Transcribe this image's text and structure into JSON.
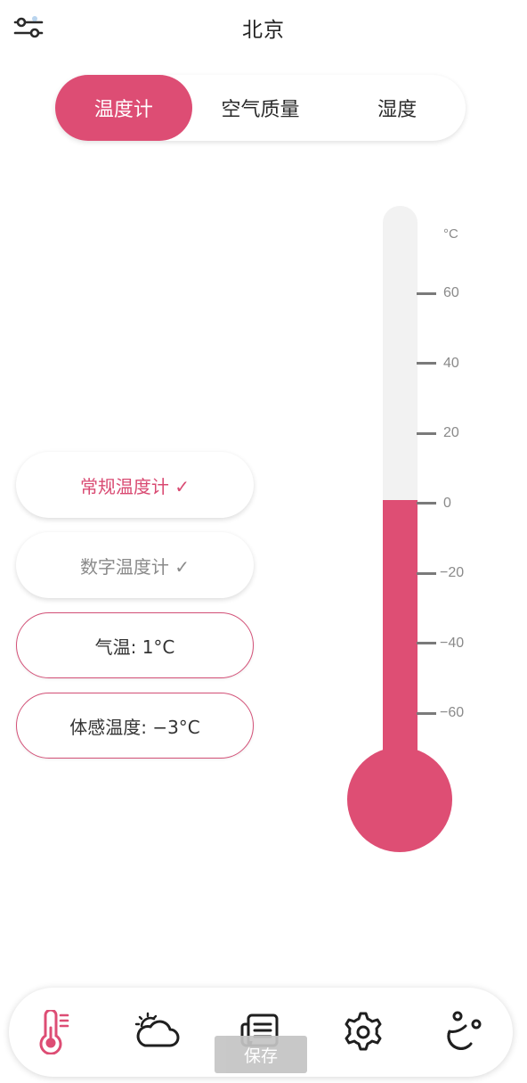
{
  "header": {
    "title": "北京",
    "filter_icon": "sliders-icon"
  },
  "tabs": [
    {
      "label": "温度计",
      "active": true
    },
    {
      "label": "空气质量",
      "active": false
    },
    {
      "label": "湿度",
      "active": false
    }
  ],
  "options": {
    "regular_thermometer": "常规温度计 ✓",
    "digital_thermometer": "数字温度计 ✓",
    "air_temp": "气温: 1°C",
    "feels_like": "体感温度: −3°C"
  },
  "thermometer": {
    "unit": "°C",
    "scale": [
      "60",
      "40",
      "20",
      "0",
      "−20",
      "−40",
      "−60"
    ],
    "fill_level_celsius": 1,
    "fill_color": "#de4e74",
    "track_color": "#f2f2f2"
  },
  "bottom_nav": {
    "items": [
      {
        "icon": "thermometer-icon",
        "active": true
      },
      {
        "icon": "sun-cloud-icon",
        "active": false
      },
      {
        "icon": "news-icon",
        "active": false
      },
      {
        "icon": "gear-icon",
        "active": false
      },
      {
        "icon": "drops-icon",
        "active": false
      }
    ],
    "save_label": "保存"
  },
  "colors": {
    "accent": "#dd4d74",
    "text": "#222222",
    "muted": "#8a8a8a"
  }
}
